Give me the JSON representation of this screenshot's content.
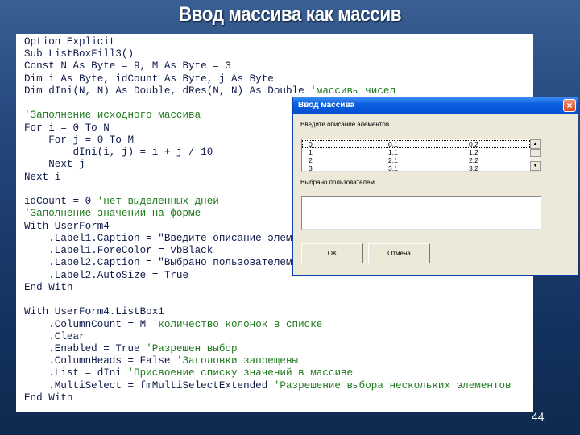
{
  "slide": {
    "title": "Ввод массива как массив",
    "page_number": "44"
  },
  "code": {
    "lines": [
      {
        "code": "Option Explicit",
        "comment": ""
      },
      {
        "code": "Sub ListBoxFill3()",
        "comment": ""
      },
      {
        "code": "Const N As Byte = 9, M As Byte = 3",
        "comment": ""
      },
      {
        "code": "Dim i As Byte, idCount As Byte, j As Byte",
        "comment": ""
      },
      {
        "code": "Dim dIni(N, N) As Double, dRes(N, N) As Double ",
        "comment": "'массивы чисел"
      },
      {
        "code": "",
        "comment": ""
      },
      {
        "code": "",
        "comment": "'Заполнение исходного массива"
      },
      {
        "code": "For i = 0 To N",
        "comment": ""
      },
      {
        "code": "    For j = 0 To M",
        "comment": ""
      },
      {
        "code": "        dIni(i, j) = i + j / 10",
        "comment": ""
      },
      {
        "code": "    Next j",
        "comment": ""
      },
      {
        "code": "Next i",
        "comment": ""
      },
      {
        "code": "",
        "comment": ""
      },
      {
        "code": "idCount = 0 ",
        "comment": "'нет выделенных дней"
      },
      {
        "code": "",
        "comment": "'Заполнение значений на форме"
      },
      {
        "code": "With UserForm4",
        "comment": ""
      },
      {
        "code": "    .Label1.Caption = \"Введите описание элем",
        "comment": ""
      },
      {
        "code": "    .Label1.ForeColor = vbBlack",
        "comment": ""
      },
      {
        "code": "    .Label2.Caption = \"Выбрано пользователем",
        "comment": ""
      },
      {
        "code": "    .Label2.AutoSize = True",
        "comment": ""
      },
      {
        "code": "End With",
        "comment": ""
      },
      {
        "code": "",
        "comment": ""
      },
      {
        "code": "With UserForm4.ListBox1",
        "comment": ""
      },
      {
        "code": "    .ColumnCount = M ",
        "comment": "'количество колонок в списке"
      },
      {
        "code": "    .Clear",
        "comment": ""
      },
      {
        "code": "    .Enabled = True ",
        "comment": "'Разрешен выбор"
      },
      {
        "code": "    .ColumnHeads = False ",
        "comment": "'Заголовки запрещены"
      },
      {
        "code": "    .List = dIni ",
        "comment": "'Присвоение списку значений в массиве"
      },
      {
        "code": "    .MultiSelect = fmMultiSelectExtended ",
        "comment": "'Разрешение выбора нескольких элементов"
      },
      {
        "code": "End With",
        "comment": ""
      }
    ]
  },
  "dialog": {
    "title": "Ввод массива",
    "close_icon": "close-x-icon",
    "label1": "Введите описание элементов",
    "list_rows": [
      [
        "0",
        "0.1",
        "0.2"
      ],
      [
        "1",
        "1.1",
        "1.2"
      ],
      [
        "2",
        "2.1",
        "2.2"
      ],
      [
        "3",
        "3.1",
        "3.2"
      ]
    ],
    "label2": "Выбрано пользователем",
    "selected_value": "",
    "ok_label": "OK",
    "cancel_label": "Отмена"
  },
  "colors": {
    "code_text": "#0d1a4a",
    "comment": "#1e7a1e",
    "titlebar": "#0a5fe0",
    "dialog_bg": "#ece9d8"
  }
}
